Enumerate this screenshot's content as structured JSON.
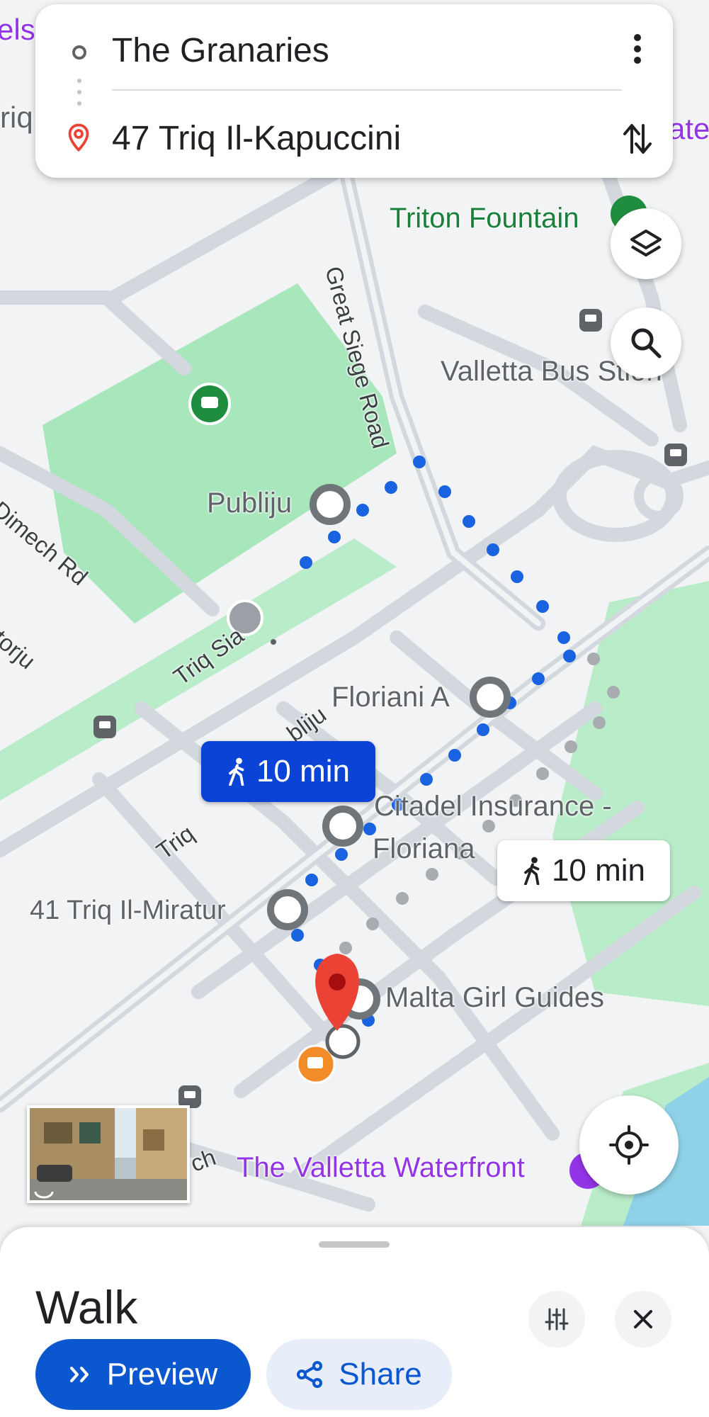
{
  "route": {
    "origin": "The Granaries",
    "destination": "47 Triq Il-Kapuccini"
  },
  "map": {
    "labels": {
      "triton_fountain": "Triton Fountain",
      "great_siege_road": "Great Siege Road",
      "valletta_bus_station": "Valletta Bus S",
      "valletta_bus_station_tail": "tion",
      "publiju": "Publiju",
      "dimech_rd": "Dimech Rd",
      "triq_s": "Triq S",
      "triq_s_suffix": "ia",
      "floriani_a": "Floriani A",
      "citadel_line1": "Citadel Insurance -",
      "citadel_line2": "Floriana",
      "triq_il_miratur": "41 Triq Il-Miratur",
      "malta_girl_guides": "Malta Girl Guides",
      "valletta_waterfront": "The Valletta Waterfront",
      "triq_left": "Triq",
      "partial_els": "els",
      "partial_riq": "riq",
      "partial_ate": "ate",
      "partial_atorju": "atorju",
      "partial_bliju": "bliju",
      "partial_ch": "ch"
    }
  },
  "bubbles": {
    "primary": "10 min",
    "secondary": "10 min"
  },
  "sheet": {
    "title": "Walk",
    "preview_label": "Preview",
    "share_label": "Share"
  },
  "colors": {
    "route_blue": "#1a63e0",
    "alt_route_gray": "#a8abb0",
    "park_green": "#a8e6bc",
    "primary_blue": "#0b57d0",
    "bubble_blue": "#0b43d6",
    "pin_red": "#ea4335"
  }
}
